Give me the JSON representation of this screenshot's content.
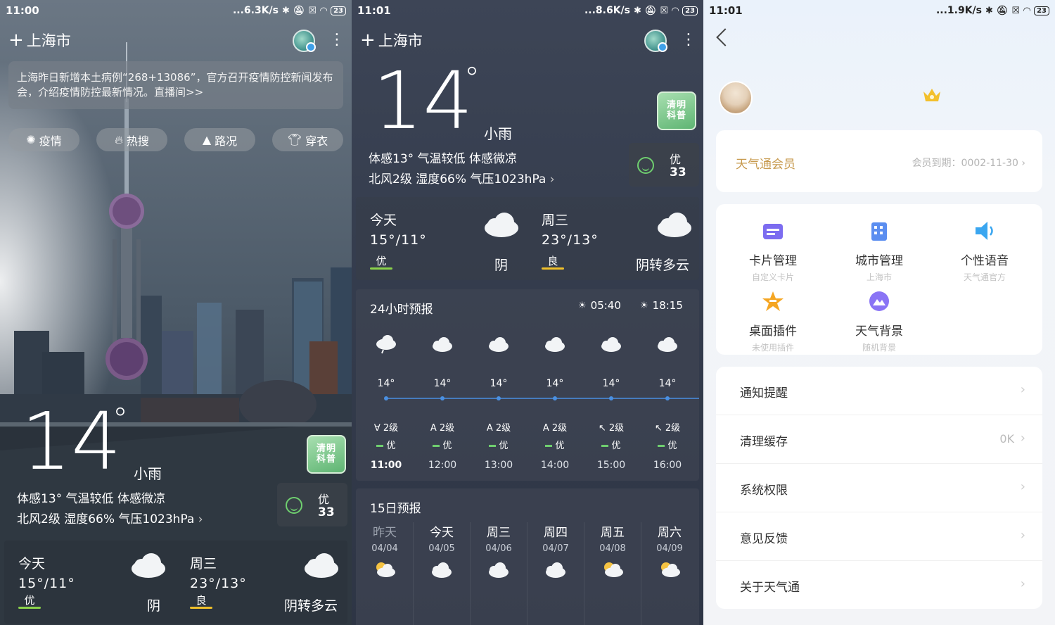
{
  "screen1": {
    "status": {
      "time": "11:00",
      "speed": "...6.3K/s",
      "battery": "23"
    },
    "city": "上海市",
    "news": "上海昨日新增本土病例“268+13086”，官方召开疫情防控新闻发布会，介绍疫情防控最新情况。直播间>>",
    "pills": [
      {
        "label": "疫情",
        "icon": "virus-icon"
      },
      {
        "label": "热搜",
        "icon": "fire-icon"
      },
      {
        "label": "路况",
        "icon": "road-icon"
      },
      {
        "label": "穿衣",
        "icon": "clothes-icon"
      }
    ],
    "temp": "14",
    "degree": "°",
    "weather": "小雨",
    "feel": "体感13° 气温较低 体感微凉",
    "detail": "北风2级  湿度66%  气压1023hPa",
    "badge": "清明\n科普",
    "aqi": {
      "level": "优",
      "value": "33"
    },
    "today": {
      "name": "今天",
      "temps": "15°/11°",
      "quality": "优",
      "weather": "阴"
    },
    "wed": {
      "name": "周三",
      "temps": "23°/13°",
      "quality": "良",
      "weather": "阴转多云"
    }
  },
  "screen2": {
    "status": {
      "time": "11:01",
      "speed": "...8.6K/s",
      "battery": "23"
    },
    "city": "上海市",
    "temp": "14",
    "degree": "°",
    "weather": "小雨",
    "feel": "体感13° 气温较低 体感微凉",
    "detail": "北风2级  湿度66%  气压1023hPa",
    "badge": "清明\n科普",
    "aqi": {
      "level": "优",
      "value": "33"
    },
    "today": {
      "name": "今天",
      "temps": "15°/11°",
      "quality": "优",
      "weather": "阴"
    },
    "wed": {
      "name": "周三",
      "temps": "23°/13°",
      "quality": "良",
      "weather": "阴转多云"
    },
    "hourly": {
      "title": "24小时预报",
      "sunrise": "05:40",
      "sunset": "18:15",
      "hours": [
        {
          "temp": "14°",
          "wind": "2级",
          "wind_dir": "∀",
          "aqi": "优",
          "time": "11:00",
          "icon": "rain-cloud-icon"
        },
        {
          "temp": "14°",
          "wind": "2级",
          "wind_dir": "A",
          "aqi": "优",
          "time": "12:00",
          "icon": "cloud-icon"
        },
        {
          "temp": "14°",
          "wind": "2级",
          "wind_dir": "A",
          "aqi": "优",
          "time": "13:00",
          "icon": "cloud-icon"
        },
        {
          "temp": "14°",
          "wind": "2级",
          "wind_dir": "A",
          "aqi": "优",
          "time": "14:00",
          "icon": "cloud-icon"
        },
        {
          "temp": "14°",
          "wind": "2级",
          "wind_dir": "↖",
          "aqi": "优",
          "time": "15:00",
          "icon": "cloud-icon"
        },
        {
          "temp": "14°",
          "wind": "2级",
          "wind_dir": "↖",
          "aqi": "优",
          "time": "16:00",
          "icon": "cloud-icon"
        }
      ]
    },
    "daily": {
      "title": "15日预报",
      "days": [
        {
          "name": "昨天",
          "date": "04/04",
          "icon": "partly-cloudy-icon"
        },
        {
          "name": "今天",
          "date": "04/05",
          "icon": "cloud-icon"
        },
        {
          "name": "周三",
          "date": "04/06",
          "icon": "cloud-icon"
        },
        {
          "name": "周四",
          "date": "04/07",
          "icon": "cloud-icon"
        },
        {
          "name": "周五",
          "date": "04/08",
          "icon": "partly-cloudy-icon"
        },
        {
          "name": "周六",
          "date": "04/09",
          "icon": "partly-cloudy-icon"
        }
      ]
    }
  },
  "screen3": {
    "status": {
      "time": "11:01",
      "speed": "...1.9K/s",
      "battery": "23"
    },
    "vip": {
      "label": "天气通会员",
      "expiry": "会员到期：0002-11-30"
    },
    "tools": [
      {
        "name": "卡片管理",
        "sub": "自定义卡片",
        "icon": "card-icon",
        "color": "#7c6cf0"
      },
      {
        "name": "城市管理",
        "sub": "上海市",
        "icon": "city-icon",
        "color": "#5b8ef0"
      },
      {
        "name": "个性语音",
        "sub": "天气通官方",
        "icon": "speaker-icon",
        "color": "#3aa6f0"
      },
      {
        "name": "桌面插件",
        "sub": "未使用插件",
        "icon": "star-widget-icon",
        "color": "#f5a623"
      },
      {
        "name": "天气背景",
        "sub": "随机背景",
        "icon": "background-icon",
        "color": "#8a74f5"
      }
    ],
    "menu": [
      {
        "label": "通知提醒",
        "value": ""
      },
      {
        "label": "清理缓存",
        "value": "0K"
      },
      {
        "label": "系统权限",
        "value": ""
      },
      {
        "label": "意见反馈",
        "value": ""
      },
      {
        "label": "关于天气通",
        "value": ""
      }
    ]
  }
}
